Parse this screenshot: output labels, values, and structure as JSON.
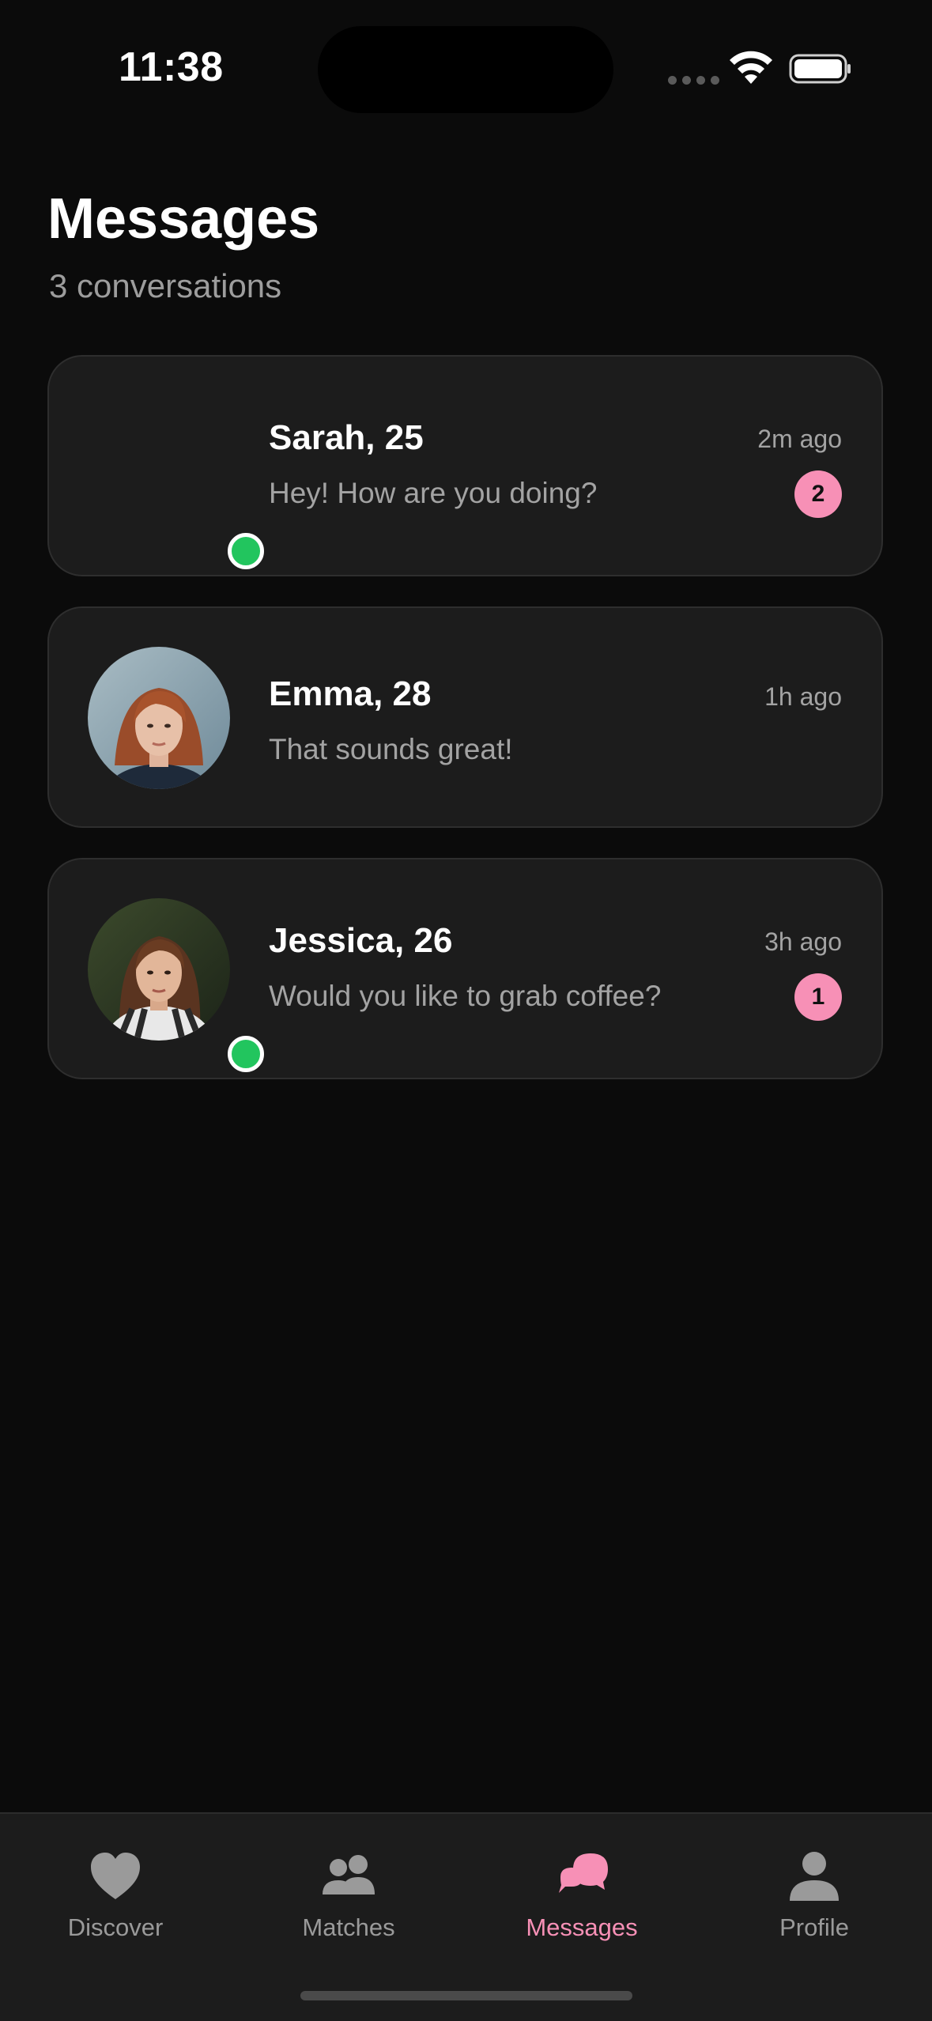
{
  "status_bar": {
    "time": "11:38"
  },
  "header": {
    "title": "Messages",
    "subtitle": "3 conversations"
  },
  "conversations": [
    {
      "name": "Sarah, 25",
      "preview": "Hey! How are you doing?",
      "time": "2m ago",
      "unread": "2",
      "online": true,
      "avatar": "none"
    },
    {
      "name": "Emma, 28",
      "preview": "That sounds great!",
      "time": "1h ago",
      "unread": "",
      "online": false,
      "avatar": "photo-woman-red-hair"
    },
    {
      "name": "Jessica, 26",
      "preview": "Would you like to grab coffee?",
      "time": "3h ago",
      "unread": "1",
      "online": true,
      "avatar": "photo-woman-brown-hair"
    }
  ],
  "tabbar": {
    "items": [
      {
        "label": "Discover",
        "icon": "heart-icon"
      },
      {
        "label": "Matches",
        "icon": "people-icon"
      },
      {
        "label": "Messages",
        "icon": "chat-bubbles-icon"
      },
      {
        "label": "Profile",
        "icon": "person-icon"
      }
    ],
    "active": "Messages"
  },
  "colors": {
    "accent": "#f790b6",
    "online": "#22c55e",
    "background": "#0b0b0b",
    "card": "#1c1c1c"
  }
}
